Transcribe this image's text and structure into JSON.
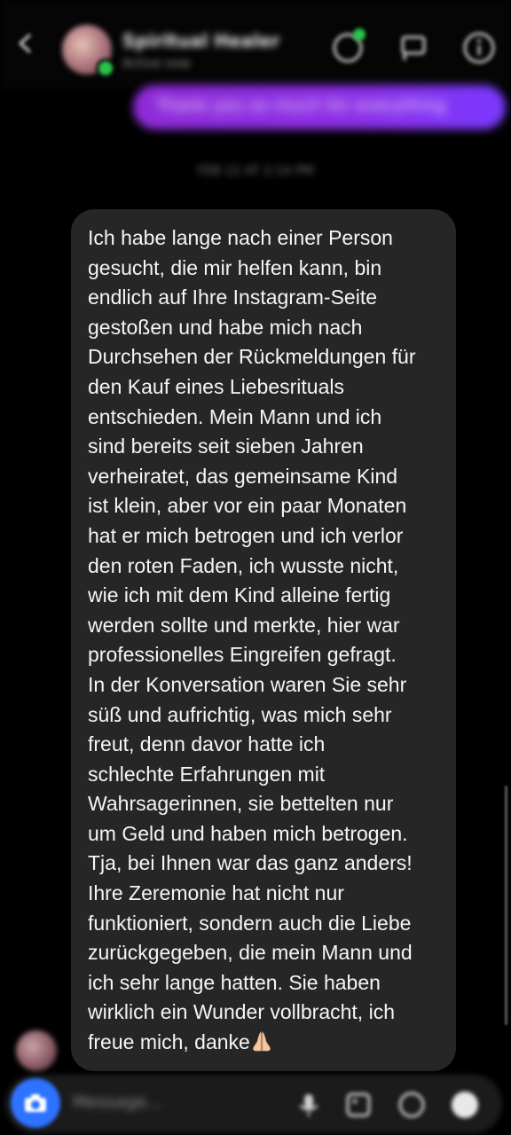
{
  "header": {
    "contact_name": "Spiritual Healer",
    "status": "Active now",
    "icons": {
      "back": "back-arrow-icon",
      "video": "video-call-icon",
      "flag": "flag-icon",
      "info": "info-icon"
    }
  },
  "outgoing_message": "Thank you so much for everything",
  "timestamp": "FEB 12 AT 2:14 PM",
  "message": {
    "lines": [
      "Ich habe lange nach einer Person",
      "gesucht, die mir helfen kann, bin",
      "endlich auf Ihre Instagram-Seite",
      "gestoßen und habe mich nach",
      "Durchsehen der Rückmeldungen für",
      "den Kauf eines Liebesrituals",
      "entschieden. Mein Mann und ich",
      "sind bereits seit sieben Jahren",
      "verheiratet, das gemeinsame Kind",
      "ist klein, aber vor ein paar Monaten",
      "hat er mich betrogen und ich verlor",
      "den roten Faden, ich wusste nicht,",
      "wie ich mit dem Kind alleine fertig",
      "werden sollte und merkte, hier war",
      "professionelles Eingreifen gefragt.",
      "In der Konversation waren Sie sehr",
      "süß und aufrichtig, was mich sehr",
      "freut, denn davor hatte ich",
      "schlechte Erfahrungen mit",
      "Wahrsagerinnen, sie bettelten nur",
      "um Geld und haben mich betrogen.",
      "Tja, bei Ihnen war das ganz anders!",
      "Ihre Zeremonie hat nicht nur",
      "funktioniert, sondern auch die Liebe",
      "zurückgegeben, die mein Mann und",
      "ich sehr lange hatten. Sie haben",
      "wirklich ein Wunder vollbracht, ich"
    ],
    "last_line": "freue mich, danke",
    "emoji_icon": "praying-hands-icon"
  },
  "composer": {
    "placeholder": "Message...",
    "icons": [
      "camera-icon",
      "microphone-icon",
      "gallery-icon",
      "sticker-icon",
      "heart-icon"
    ]
  },
  "colors": {
    "background": "#000000",
    "incoming_bubble": "#262626",
    "outgoing_bubble": "#8b2fe6",
    "camera_button": "#2e73ff",
    "online": "#2bc44a"
  }
}
